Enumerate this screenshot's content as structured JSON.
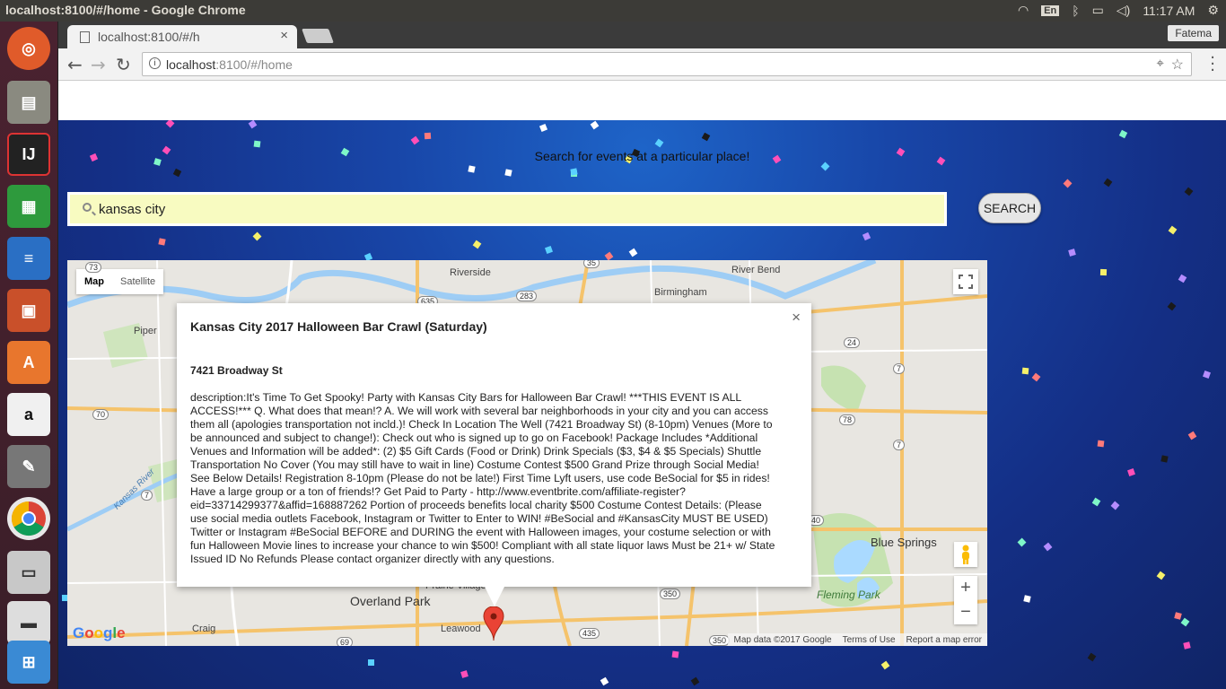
{
  "os": {
    "window_title": "localhost:8100/#/home - Google Chrome",
    "keyboard_lang": "En",
    "clock": "11:17 AM",
    "launcher_apps": [
      "Ubuntu Dash",
      "Files",
      "IntelliJ IDEA",
      "LibreOffice Calc",
      "LibreOffice Writer",
      "LibreOffice Impress",
      "Ubuntu Software",
      "Amazon",
      "System Settings",
      "Google Chrome",
      "Disks",
      "Scanner",
      "Remote Desktop"
    ]
  },
  "browser": {
    "tab_title": "localhost:8100/#/h",
    "profile": "Fatema",
    "url_host": "localhost",
    "url_path": ":8100/#/home"
  },
  "page": {
    "tagline": "Search for events at a particular place!",
    "search_value": "kansas city",
    "search_button": "SEARCH"
  },
  "map": {
    "map_type_map": "Map",
    "map_type_satellite": "Satellite",
    "places": {
      "riverside": "Riverside",
      "river_bend": "River Bend",
      "birmingham": "Birmingham",
      "piper": "Piper",
      "blue_springs": "Blue Springs",
      "fleming_park": "Fleming Park",
      "overland_park": "Overland Park",
      "prairie_village": "Prairie Village",
      "leawood": "Leawood",
      "craig": "Craig",
      "kansas_river": "Kansas River"
    },
    "road_shields": [
      "73",
      "635",
      "283",
      "35",
      "24",
      "7",
      "78",
      "70",
      "7",
      "7",
      "350",
      "435",
      "69",
      "40",
      "350"
    ],
    "zoom_in": "+",
    "zoom_out": "−",
    "logo": "Google",
    "attribution": {
      "data": "Map data ©2017 Google",
      "terms": "Terms of Use",
      "report": "Report a map error"
    }
  },
  "infowindow": {
    "title": "Kansas City 2017 Halloween Bar Crawl (Saturday)",
    "address": "7421 Broadway St",
    "description": "description:It's Time To Get Spooky! Party with Kansas City Bars for Halloween Bar Crawl! ***THIS EVENT IS ALL ACCESS!*** Q. What does that mean!? A. We will work with several bar neighborhoods in your city and you can access them all (apologies transportation not incld.)! Check In Location The Well (7421 Broadway St) (8-10pm) Venues (More to be announced and subject to change!): Check out who is signed up to go on Facebook! Package Includes *Additional Venues and Information will be added*: (2) $5 Gift Cards (Food or Drink) Drink Specials ($3, $4 & $5 Specials) Shuttle Transportation No Cover (You may still have to wait in line) Costume Contest $500 Grand Prize through Social Media! See Below Details! Registration 8-10pm (Please do not be late!) First Time Lyft users, use code BeSocial for $5 in rides! Have a large group or a ton of friends!? Get Paid to Party - http://www.eventbrite.com/affiliate-register?eid=33714299377&affid=168887262 Portion of proceeds benefits local charity $500 Costume Contest Details: (Please use social media outlets Facebook, Instagram or Twitter to Enter to WIN! #BeSocial and #KansasCity MUST BE USED) Twitter or Instagram #BeSocial BEFORE and DURING the event with Halloween images, your costume selection or with fun Halloween Movie lines to increase your chance to win $500! Compliant with all state liquor laws Must be 21+ w/ State Issued ID No Refunds Please contact organizer directly with any questions.",
    "close_icon": "×"
  }
}
